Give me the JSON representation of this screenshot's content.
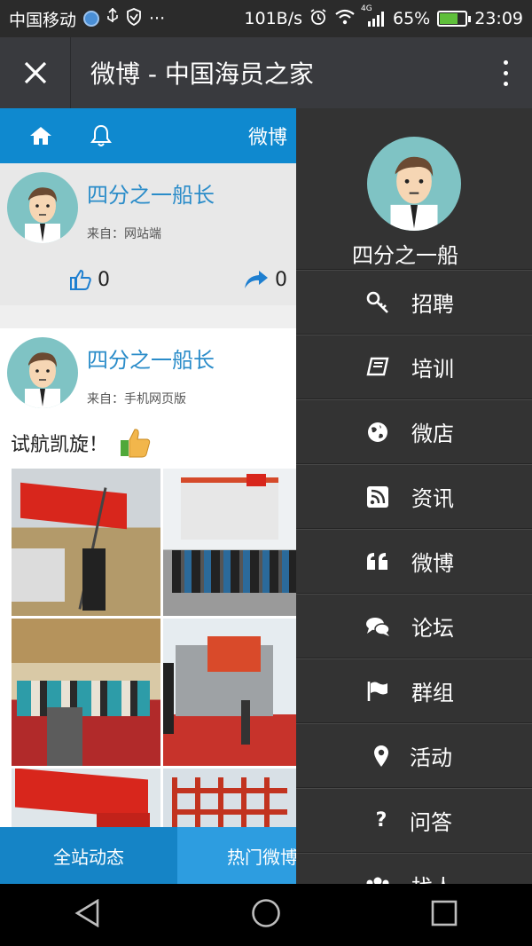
{
  "status_bar": {
    "carrier": "中国移动",
    "speed": "101B/s",
    "network": "4G",
    "battery": "65%",
    "time": "23:09",
    "battery_level": 0.65
  },
  "titlebar": {
    "title": "微博 - 中国海员之家"
  },
  "subnav": {
    "weibo_label": "微博"
  },
  "posts": [
    {
      "username": "四分之一船长",
      "source": "来自：网站端",
      "likes": "0",
      "shares": "0"
    },
    {
      "username": "四分之一船长",
      "source": "来自：手机网页版",
      "text": "试航凯旋！"
    }
  ],
  "tabs": {
    "all": "全站动态",
    "hot": "热门微博"
  },
  "side_menu": {
    "profile_name": "四分之一船",
    "items": [
      {
        "label": "招聘",
        "icon": "key-icon"
      },
      {
        "label": "培训",
        "icon": "book-icon"
      },
      {
        "label": "微店",
        "icon": "globe-icon"
      },
      {
        "label": "资讯",
        "icon": "rss-icon"
      },
      {
        "label": "微博",
        "icon": "quote-icon"
      },
      {
        "label": "论坛",
        "icon": "comments-icon"
      },
      {
        "label": "群组",
        "icon": "flag-icon"
      },
      {
        "label": "活动",
        "icon": "map-marker-icon"
      },
      {
        "label": "问答",
        "icon": "question-icon"
      },
      {
        "label": "找人",
        "icon": "users-icon"
      }
    ]
  },
  "colors": {
    "accent": "#0f89cf",
    "username": "#2a8cc9",
    "menu_bg": "#333333"
  }
}
